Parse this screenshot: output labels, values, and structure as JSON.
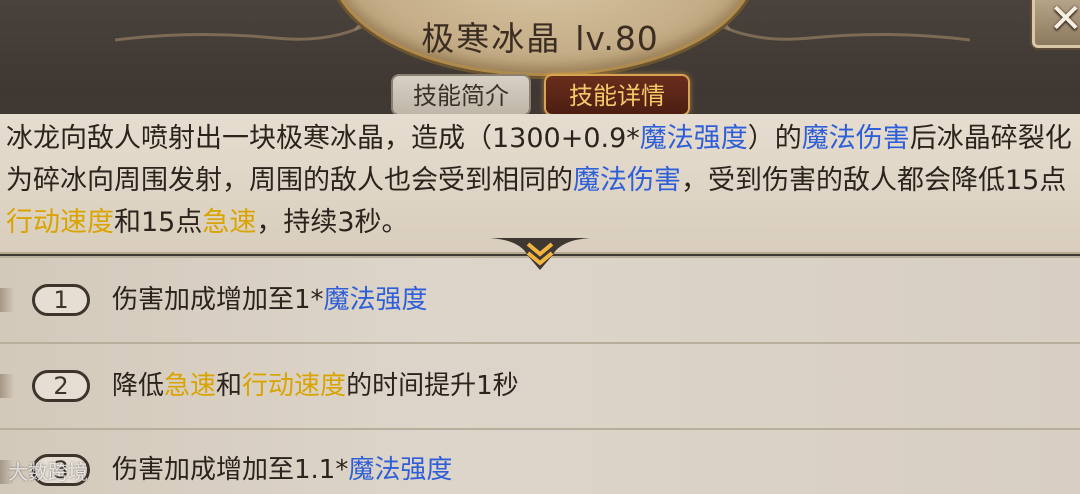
{
  "skill": {
    "name": "极寒冰晶",
    "level": "lv.80"
  },
  "tabs": {
    "intro": "技能简介",
    "detail": "技能详情"
  },
  "close_icon": "close-x",
  "description": {
    "p1": "冰龙向敌人喷射出一块极寒冰晶，造成（1300+0.9*",
    "p2": "魔法强度",
    "p3": "）的",
    "p4": "魔法伤害",
    "p5": "后冰晶碎裂化为碎冰向周围发射，周围的敌人也会受到相同的",
    "p6": "魔法伤害",
    "p7": "，受到伤害的敌人都会降低15点",
    "p8": "行动速度",
    "p9": "和15点",
    "p10": "急速",
    "p11": "，持续3秒。"
  },
  "upgrades": [
    {
      "num": "1",
      "a": "伤害加成增加至1*",
      "b": "魔法强度"
    },
    {
      "num": "2",
      "a": "降低",
      "b": "急速",
      "c": "和",
      "d": "行动速度",
      "e": "的时间提升1秒"
    },
    {
      "num": "3",
      "a": "伤害加成增加至1.1*",
      "b": "魔法强度"
    }
  ],
  "watermark": "大数跨境",
  "colors": {
    "magic": "#2f5fd8",
    "speed": "#d9a400",
    "tab_active": "#f5c96a"
  }
}
